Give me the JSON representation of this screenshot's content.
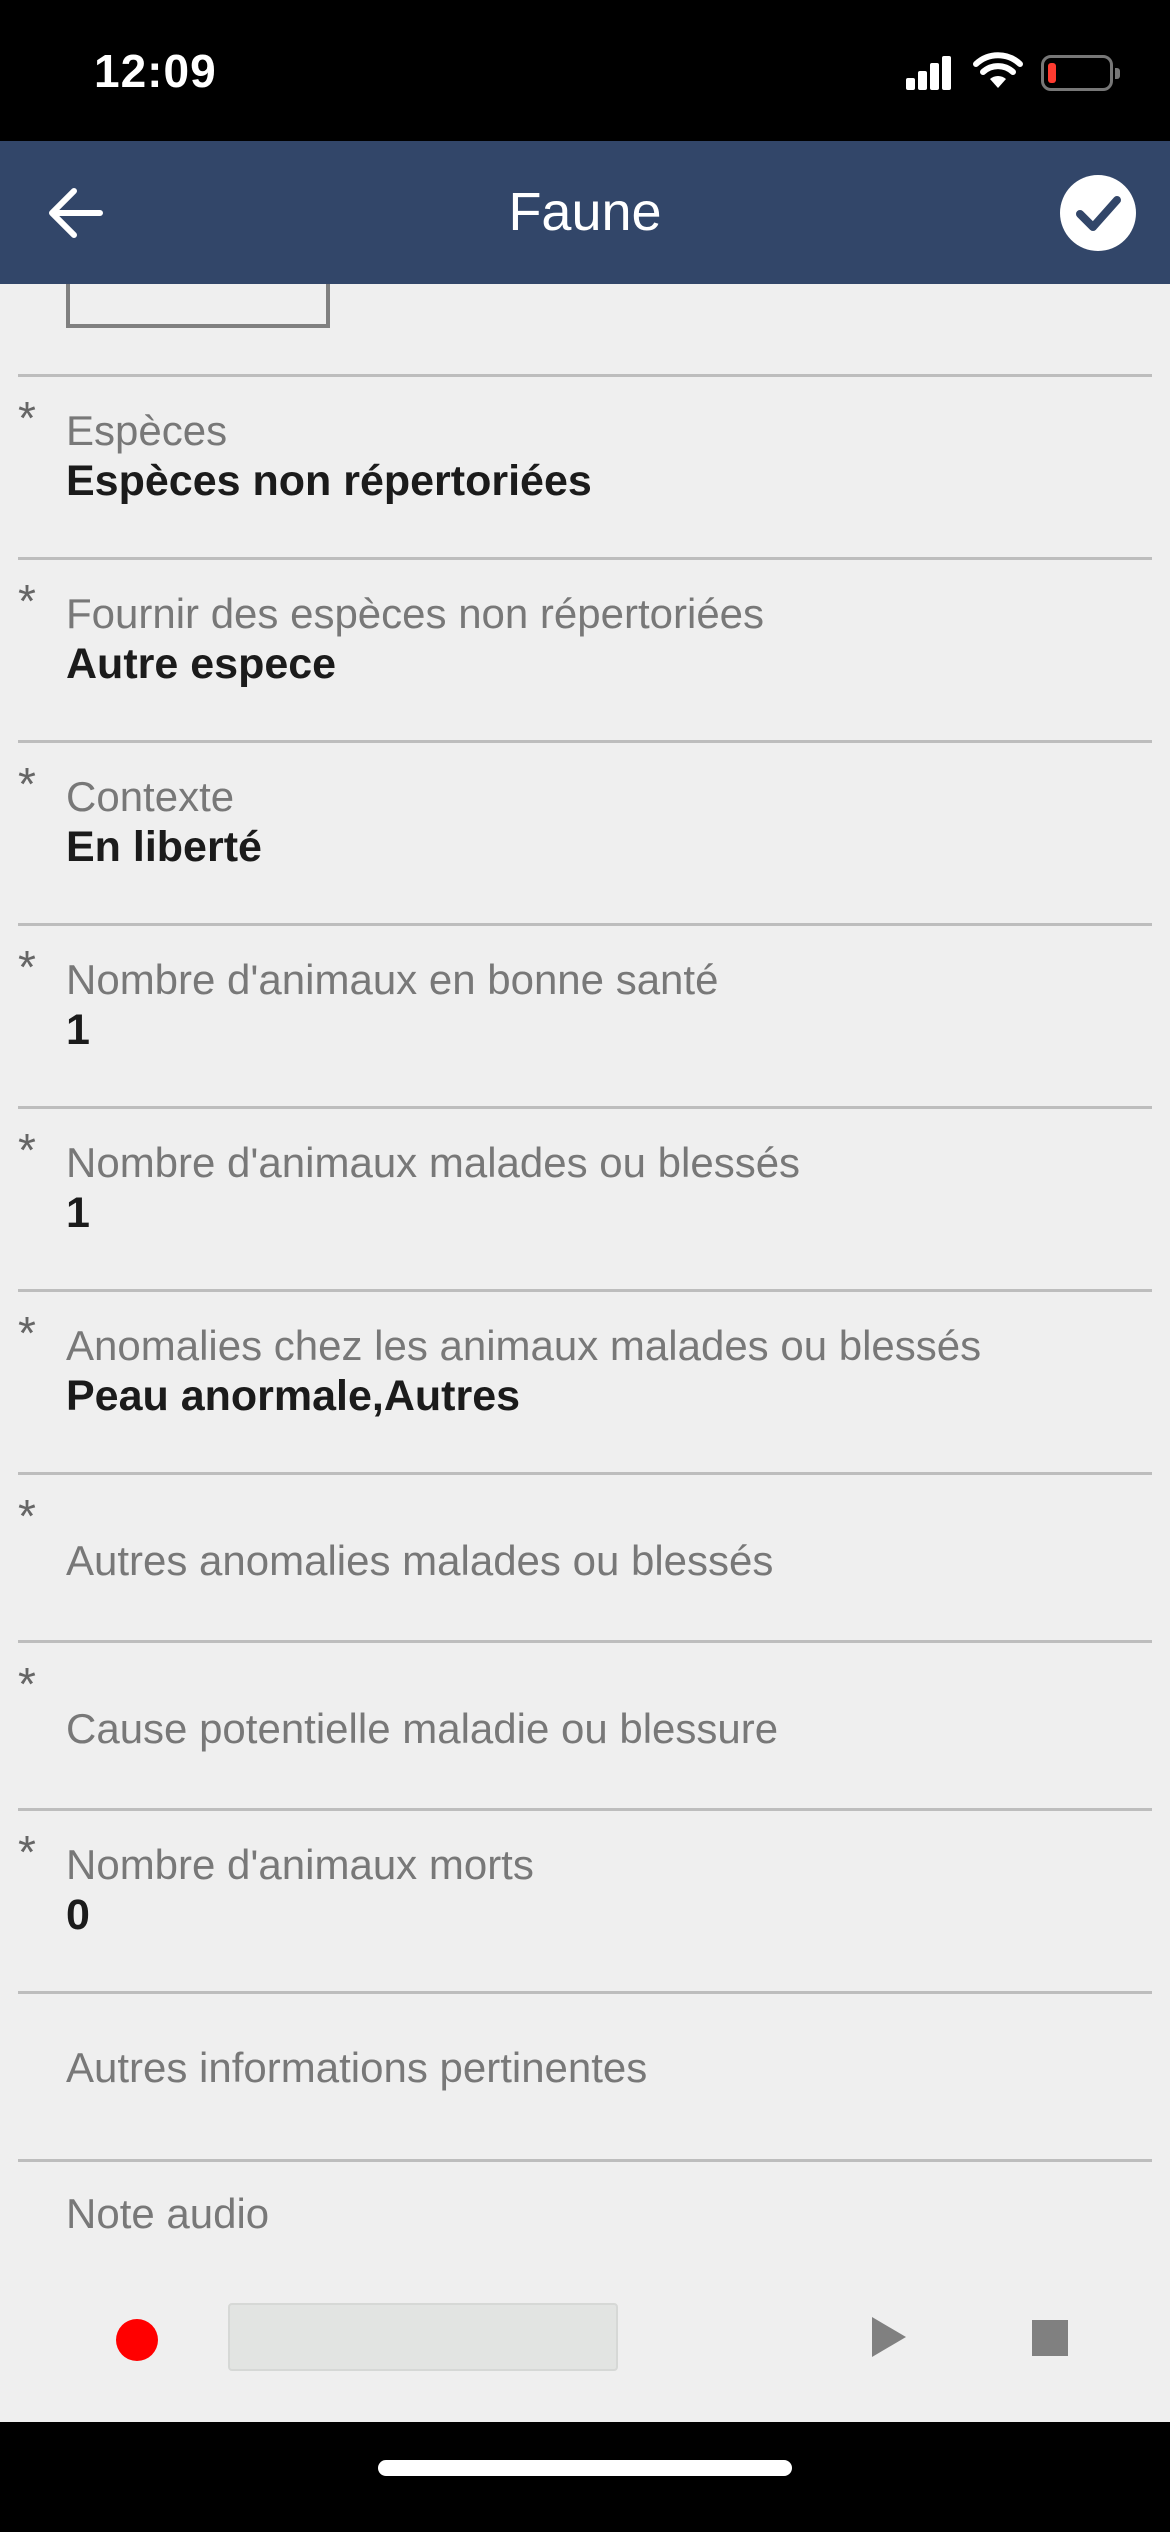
{
  "status_bar": {
    "time": "12:09",
    "icons": [
      "cellular-signal-icon",
      "wifi-icon",
      "battery-low-icon"
    ],
    "battery_color": "#ff3b30"
  },
  "nav": {
    "title": "Faune",
    "back_icon": "arrow-left-icon",
    "confirm_icon": "checkmark-circle-icon",
    "background": "#324669"
  },
  "form": {
    "required_marker": "*",
    "fields": [
      {
        "label": "Espèces",
        "value": "Espèces non répertoriées",
        "required": true
      },
      {
        "label": "Fournir des espèces non répertoriées",
        "value": "Autre espece",
        "required": true
      },
      {
        "label": "Contexte",
        "value": "En liberté",
        "required": true
      },
      {
        "label": "Nombre d'animaux en bonne santé",
        "value": "1",
        "required": true
      },
      {
        "label": "Nombre d'animaux malades ou blessés",
        "value": "1",
        "required": true
      },
      {
        "label": "Anomalies chez les animaux malades ou blessés",
        "value": "Peau anormale,Autres",
        "required": true
      },
      {
        "label": "Autres anomalies malades ou blessés",
        "value": "",
        "required": true
      },
      {
        "label": "Cause potentielle maladie ou blessure",
        "value": "",
        "required": true
      },
      {
        "label": "Nombre d'animaux morts",
        "value": "0",
        "required": true
      },
      {
        "label": "Autres informations pertinentes",
        "value": "",
        "required": false
      }
    ],
    "audio": {
      "label": "Note audio",
      "record_icon": "record-icon",
      "play_icon": "play-icon",
      "stop_icon": "stop-icon",
      "record_color": "#ff0000"
    }
  }
}
